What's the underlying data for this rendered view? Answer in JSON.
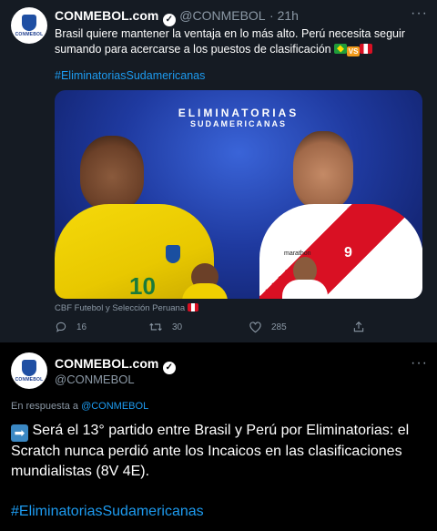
{
  "tweet1": {
    "author_name": "CONMEBOL.com",
    "handle": "@CONMEBOL",
    "time": "· 21h",
    "more": "···",
    "avatar_text": "CONMEBOL",
    "text": "Brasil quiere mantener la ventaja en lo más alto. Perú necesita seguir sumando para acercarse a los puestos de clasificación",
    "flag_vs": "VS",
    "hashtag": "#EliminatoriasSudamericanas",
    "image": {
      "title_line1": "ELIMINATORIAS",
      "title_line2": "SUDAMERICANAS",
      "shirt_number_left": "10",
      "shirt_number_right": "9",
      "sponsor_right": "marathon"
    },
    "credit": "CBF Futebol y Selección Peruana",
    "actions": {
      "replies": "16",
      "retweets": "30",
      "likes": "285"
    }
  },
  "tweet2": {
    "author_name": "CONMEBOL.com",
    "handle": "@CONMEBOL",
    "more": "···",
    "avatar_text": "CONMEBOL",
    "reply_prefix": "En respuesta a",
    "reply_handle": "@CONMEBOL",
    "arrow": "➡",
    "text": " Será el 13° partido entre Brasil y Perú por Eliminatorias: el Scratch nunca perdió ante los Incaicos en las clasificaciones mundialistas (8V 4E).",
    "hashtag": "#EliminatoriasSudamericanas"
  },
  "colors": {
    "accent": "#1d9bf0",
    "tweet_bg": "#151b23",
    "page_bg": "#000000"
  }
}
